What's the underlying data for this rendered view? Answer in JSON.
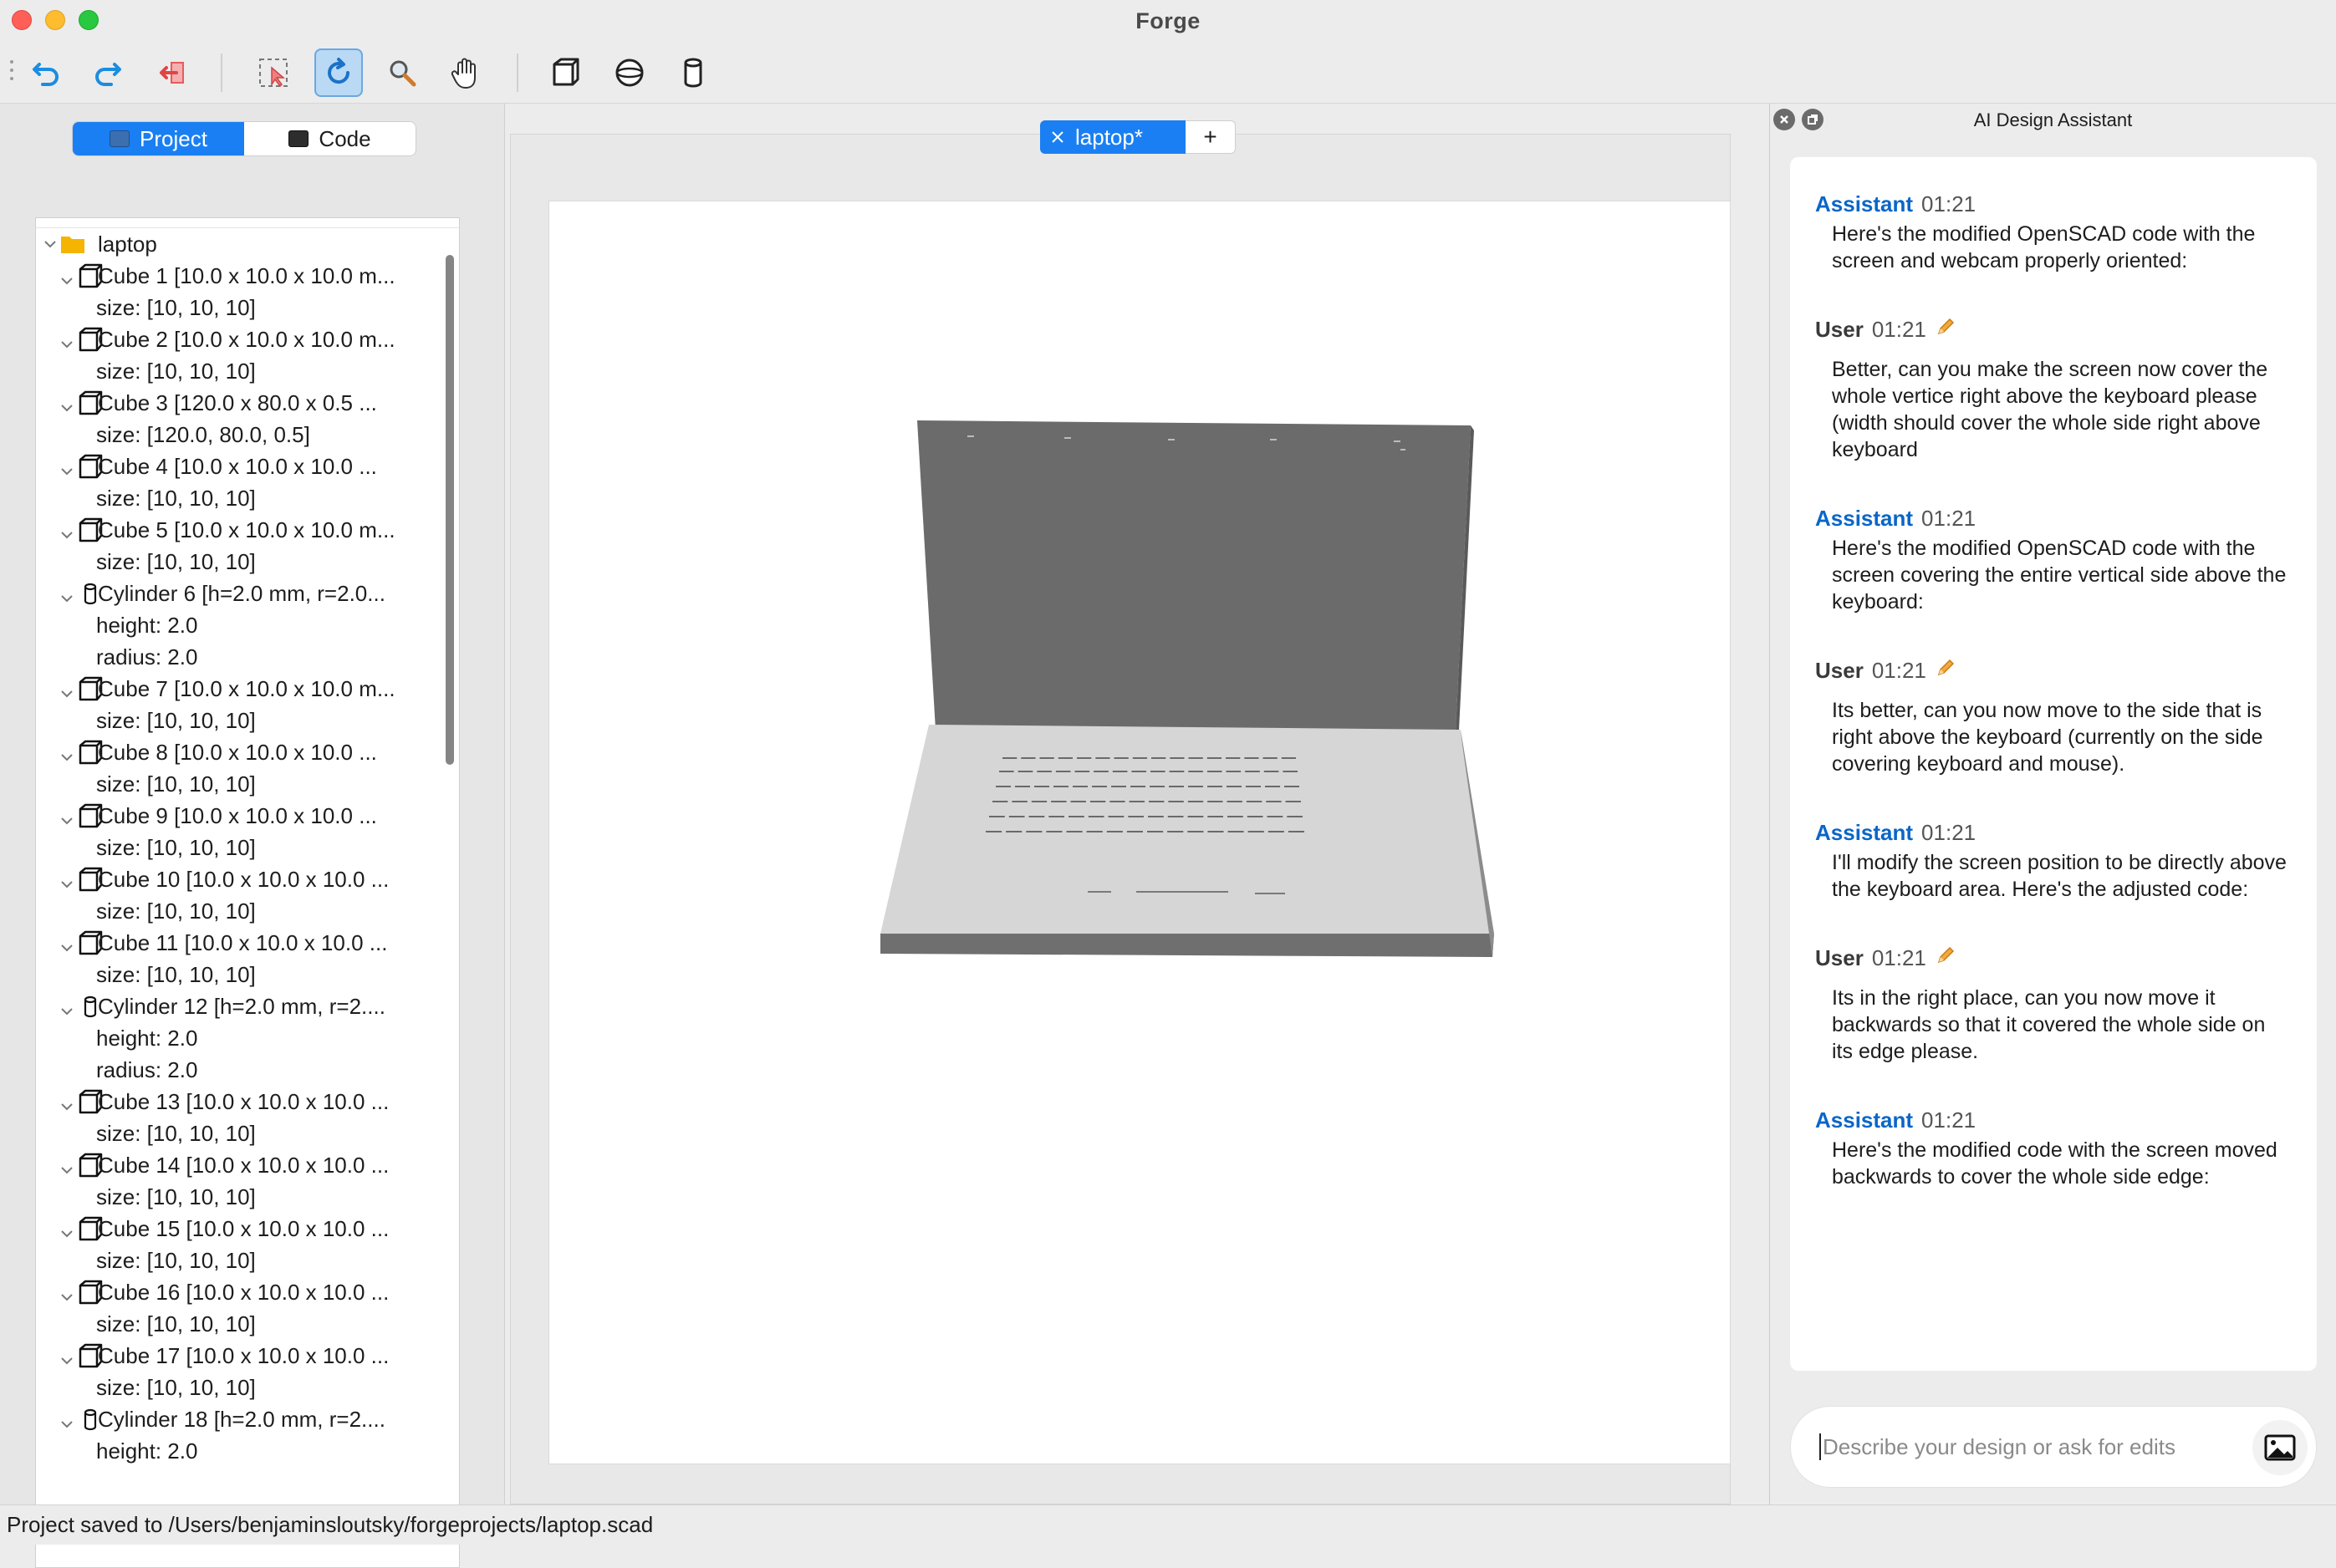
{
  "window": {
    "title": "Forge"
  },
  "toolbar": {
    "buttons": [
      {
        "name": "undo-icon"
      },
      {
        "name": "redo-icon"
      },
      {
        "name": "exit-icon"
      },
      {
        "name": "select-icon"
      },
      {
        "name": "rotate-icon",
        "active": true
      },
      {
        "name": "zoom-icon"
      },
      {
        "name": "pan-hand-icon"
      },
      {
        "name": "cube-view-icon"
      },
      {
        "name": "sphere-view-icon"
      },
      {
        "name": "cylinder-view-icon"
      }
    ]
  },
  "left_panel": {
    "tabs": [
      {
        "label": "Project",
        "active": true
      },
      {
        "label": "Code",
        "active": false
      }
    ],
    "tree": {
      "root": "laptop",
      "items": [
        {
          "kind": "cube",
          "label": "Cube 1 [10.0 x 10.0 x 10.0 m...",
          "props": [
            "size: [10, 10, 10]"
          ]
        },
        {
          "kind": "cube",
          "label": "Cube 2 [10.0 x 10.0 x 10.0 m...",
          "props": [
            "size: [10, 10, 10]"
          ]
        },
        {
          "kind": "cube",
          "label": "Cube 3 [120.0 x 80.0 x 0.5 ...",
          "props": [
            "size: [120.0, 80.0, 0.5]"
          ]
        },
        {
          "kind": "cube",
          "label": "Cube 4 [10.0 x 10.0 x 10.0 ...",
          "props": [
            "size: [10, 10, 10]"
          ]
        },
        {
          "kind": "cube",
          "label": "Cube 5 [10.0 x 10.0 x 10.0 m...",
          "props": [
            "size: [10, 10, 10]"
          ]
        },
        {
          "kind": "cylinder",
          "label": "Cylinder 6 [h=2.0 mm, r=2.0...",
          "props": [
            "height: 2.0",
            "radius: 2.0"
          ]
        },
        {
          "kind": "cube",
          "label": "Cube 7 [10.0 x 10.0 x 10.0 m...",
          "props": [
            "size: [10, 10, 10]"
          ]
        },
        {
          "kind": "cube",
          "label": "Cube 8 [10.0 x 10.0 x 10.0 ...",
          "props": [
            "size: [10, 10, 10]"
          ]
        },
        {
          "kind": "cube",
          "label": "Cube 9 [10.0 x 10.0 x 10.0 ...",
          "props": [
            "size: [10, 10, 10]"
          ]
        },
        {
          "kind": "cube",
          "label": "Cube 10 [10.0 x 10.0 x 10.0 ...",
          "props": [
            "size: [10, 10, 10]"
          ]
        },
        {
          "kind": "cube",
          "label": "Cube 11 [10.0 x 10.0 x 10.0 ...",
          "props": [
            "size: [10, 10, 10]"
          ]
        },
        {
          "kind": "cylinder",
          "label": "Cylinder 12 [h=2.0 mm, r=2....",
          "props": [
            "height: 2.0",
            "radius: 2.0"
          ]
        },
        {
          "kind": "cube",
          "label": "Cube 13 [10.0 x 10.0 x 10.0 ...",
          "props": [
            "size: [10, 10, 10]"
          ]
        },
        {
          "kind": "cube",
          "label": "Cube 14 [10.0 x 10.0 x 10.0 ...",
          "props": [
            "size: [10, 10, 10]"
          ]
        },
        {
          "kind": "cube",
          "label": "Cube 15 [10.0 x 10.0 x 10.0 ...",
          "props": [
            "size: [10, 10, 10]"
          ]
        },
        {
          "kind": "cube",
          "label": "Cube 16 [10.0 x 10.0 x 10.0 ...",
          "props": [
            "size: [10, 10, 10]"
          ]
        },
        {
          "kind": "cube",
          "label": "Cube 17 [10.0 x 10.0 x 10.0 ...",
          "props": [
            "size: [10, 10, 10]"
          ]
        },
        {
          "kind": "cylinder",
          "label": "Cylinder 18 [h=2.0 mm, r=2....",
          "props": [
            "height: 2.0"
          ]
        }
      ]
    }
  },
  "editor": {
    "tab": {
      "label": "laptop*"
    },
    "add_tab_label": "+"
  },
  "assistant": {
    "title": "AI Design Assistant",
    "messages": [
      {
        "role": "Assistant",
        "time": "01:21",
        "text": "Here's the modified OpenSCAD code with the screen and webcam properly oriented:"
      },
      {
        "role": "User",
        "time": "01:21",
        "text": "Better, can you make the screen now cover the whole vertice right above the keyboard please (width should cover the whole side right above keyboard"
      },
      {
        "role": "Assistant",
        "time": "01:21",
        "text": "Here's the modified OpenSCAD code with the screen covering the entire vertical side above the keyboard:"
      },
      {
        "role": "User",
        "time": "01:21",
        "text": "Its better, can you now move to the side that is right above the keyboard (currently on the side covering keyboard and mouse)."
      },
      {
        "role": "Assistant",
        "time": "01:21",
        "text": "I'll modify the screen position to be directly above the keyboard area. Here's the adjusted code:"
      },
      {
        "role": "User",
        "time": "01:21",
        "text": "Its in the right place, can you now move it backwards so that it covered the whole side on its edge please."
      },
      {
        "role": "Assistant",
        "time": "01:21",
        "text": "Here's the modified code with the screen moved backwards to cover the whole side edge:"
      }
    ],
    "input_placeholder": "Describe your design or ask for edits"
  },
  "status": {
    "text": "Project saved to /Users/benjaminsloutsky/forgeprojects/laptop.scad"
  },
  "colors": {
    "accent": "#1a7ff2",
    "assistant_name": "#0a66c8",
    "folder": "#f5b400"
  }
}
